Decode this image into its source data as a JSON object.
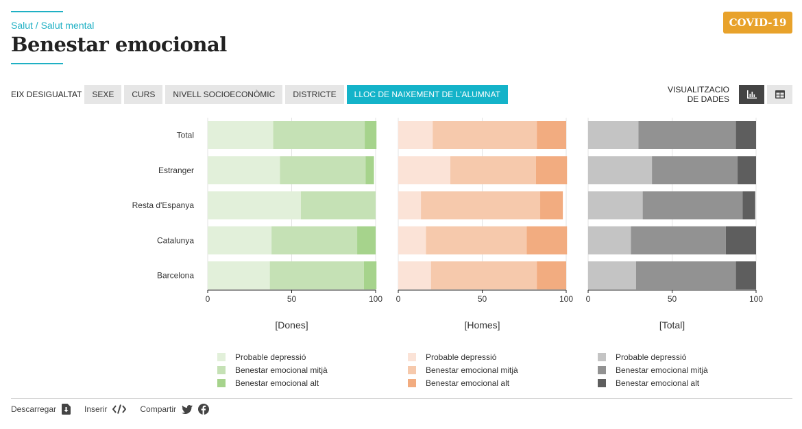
{
  "header": {
    "breadcrumb": "Salut / Salut mental",
    "title": "Benestar emocional",
    "badge": "COVID-19"
  },
  "filters": {
    "label": "EIX DESIGUALTAT",
    "tabs": [
      "SEXE",
      "CURS",
      "NIVELL SOCIOECONÒMIC",
      "DISTRICTE",
      "LLOC DE NAIXEMENT DE L'ALUMNAT"
    ],
    "active_tab": "LLOC DE NAIXEMENT DE L'ALUMNAT"
  },
  "visualization": {
    "label_line1": "VISUALITZACIO",
    "label_line2": "DE DADES",
    "chart_icon": "bar-chart-icon",
    "table_icon": "table-icon"
  },
  "colors": {
    "accent": "#1fb0c4",
    "badge": "#e8a22b",
    "dones": [
      "#e2f0da",
      "#c5e1b5",
      "#a6d38c"
    ],
    "homes": [
      "#fbe3d7",
      "#f6c9ac",
      "#f2ac80"
    ],
    "total": [
      "#c4c4c4",
      "#929292",
      "#5e5e5e"
    ]
  },
  "chart_data": {
    "type": "bar",
    "orientation": "horizontal",
    "stacked": true,
    "categories": [
      "Total",
      "Estranger",
      "Resta d'Espanya",
      "Catalunya",
      "Barcelona"
    ],
    "xlim": [
      0,
      100
    ],
    "xticks": [
      0,
      50,
      100
    ],
    "grid": true,
    "panels": [
      {
        "title": "[Dones]",
        "series": [
          {
            "name": "Probable depressió",
            "values": [
              39,
              43,
              55.5,
              38,
              37
            ]
          },
          {
            "name": "Benestar emocional mitjà",
            "values": [
              54.5,
              51,
              44.5,
              51,
              56
            ]
          },
          {
            "name": "Benestar emocional alt",
            "values": [
              7,
              5,
              0,
              11,
              7.5
            ]
          }
        ]
      },
      {
        "title": "[Homes]",
        "series": [
          {
            "name": "Probable depressió",
            "values": [
              20.5,
              31,
              13.5,
              16.5,
              19.5
            ]
          },
          {
            "name": "Benestar emocional mitjà",
            "values": [
              62,
              51,
              71,
              60,
              63
            ]
          },
          {
            "name": "Benestar emocional alt",
            "values": [
              17.5,
              18.5,
              13.5,
              24,
              17.5
            ]
          }
        ]
      },
      {
        "title": "[Total]",
        "series": [
          {
            "name": "Probable depressió",
            "values": [
              30,
              38,
              32.5,
              25.5,
              28.5
            ]
          },
          {
            "name": "Benestar emocional mitjà",
            "values": [
              58,
              51,
              59.5,
              56.5,
              59.5
            ]
          },
          {
            "name": "Benestar emocional alt",
            "values": [
              12,
              11,
              7.5,
              18,
              12
            ]
          }
        ]
      }
    ]
  },
  "footer": {
    "download": "Descarregar",
    "embed": "Inserir",
    "share": "Compartir"
  }
}
